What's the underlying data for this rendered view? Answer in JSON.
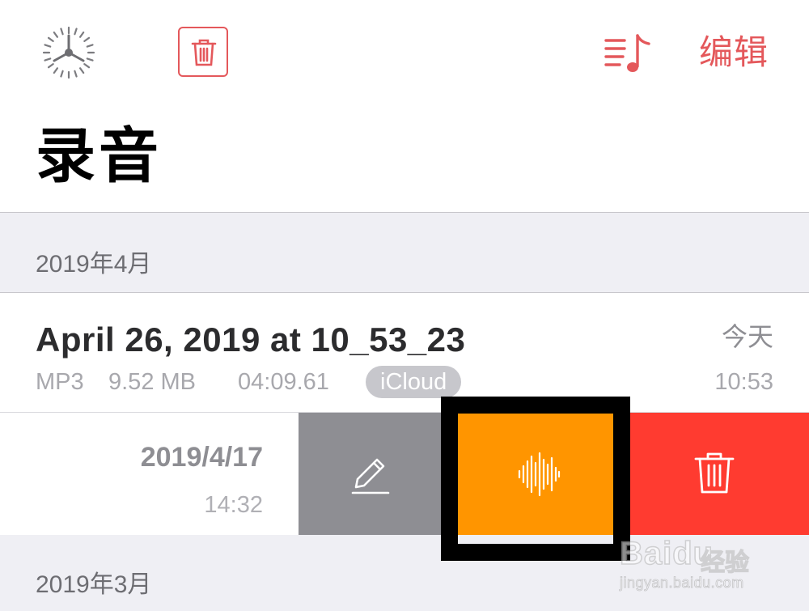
{
  "toolbar": {
    "dial_icon": "settings-dial-icon",
    "trash_icon": "trash-icon",
    "playlist_icon": "playlist-music-icon",
    "edit_label": "编辑"
  },
  "page": {
    "title": "录音"
  },
  "sections": [
    {
      "label": "2019年4月"
    },
    {
      "label": "2019年3月"
    }
  ],
  "recordings": [
    {
      "title": "April 26, 2019 at 10_53_23",
      "date": "今天",
      "time": "10:53",
      "format": "MP3",
      "size": "9.52 MB",
      "duration": "04:09.61",
      "badge": "iCloud"
    },
    {
      "date": "2019/4/17",
      "time": "14:32"
    }
  ],
  "swipe_actions": [
    {
      "icon": "pencil-icon",
      "color": "#8e8e93"
    },
    {
      "icon": "waveform-icon",
      "color": "#ff9500"
    },
    {
      "icon": "trash-icon",
      "color": "#ff3b30"
    }
  ],
  "watermark": {
    "brand": "Baidu",
    "sub": "经验",
    "url": "jingyan.baidu.com"
  },
  "colors": {
    "accent": "#e4585b",
    "highlight": "#000000"
  }
}
